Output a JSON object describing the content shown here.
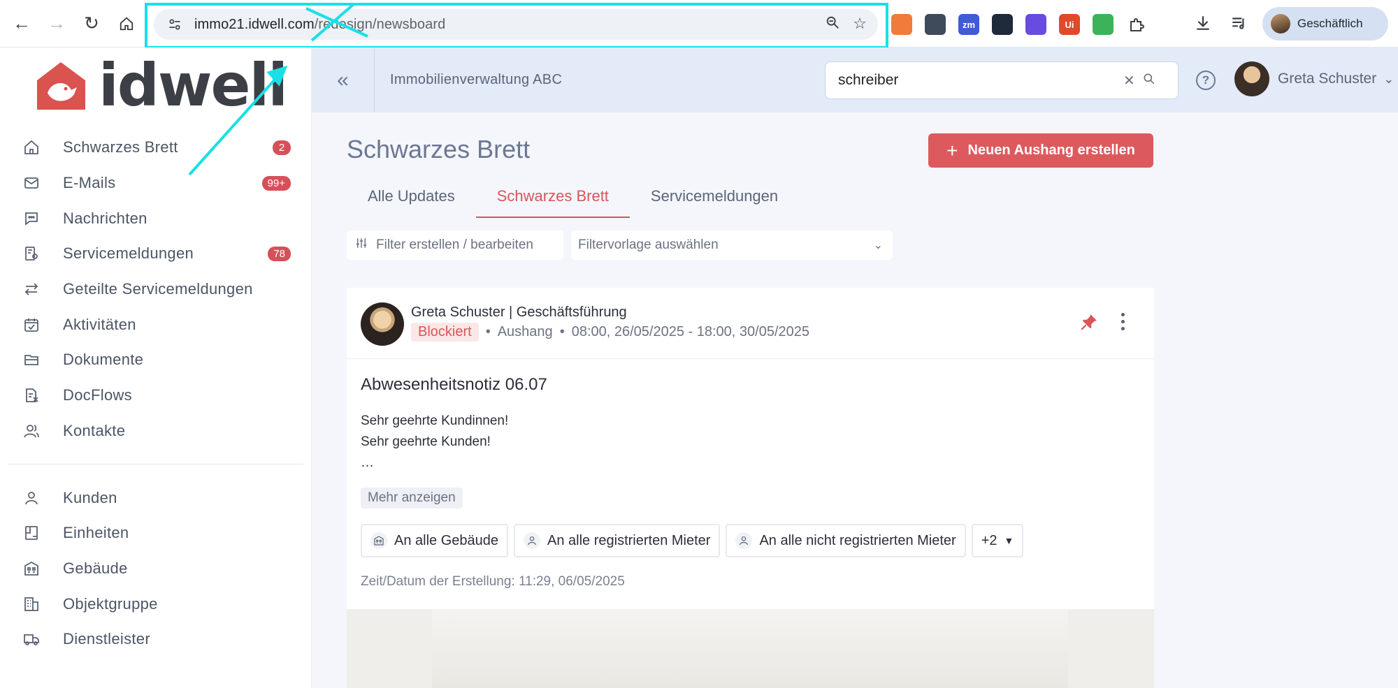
{
  "browser": {
    "url_host": "immo21.idwell.com",
    "url_path_struck": "/redesign",
    "url_path_rest": "/newsboard",
    "profile_label": "Geschäftlich",
    "extensions": [
      {
        "name": "layout-extension",
        "color": "#f07b3a",
        "text": ""
      },
      {
        "name": "puzzle-tool-extension",
        "color": "#3f4a5a",
        "text": ""
      },
      {
        "name": "zm-extension",
        "color": "#3f5bd6",
        "text": "zm"
      },
      {
        "name": "hex-extension",
        "color": "#1f2a3a",
        "text": ""
      },
      {
        "name": "star-extension",
        "color": "#6a4be0",
        "text": ""
      },
      {
        "name": "ui-extension",
        "color": "#e04a2a",
        "text": "Ui"
      },
      {
        "name": "code-extension",
        "color": "#3cb35a",
        "text": ""
      },
      {
        "name": "puzzle-extension",
        "color": "#ffffff",
        "text": ""
      }
    ]
  },
  "app": {
    "logo_text": "idwell",
    "org_name": "Immobilienverwaltung ABC",
    "search": {
      "value": "schreiber"
    },
    "user_name": "Greta Schuster"
  },
  "sidebar": {
    "primary": [
      {
        "id": "schwarzes-brett",
        "label": "Schwarzes Brett",
        "badge": "2",
        "icon": "home-icon"
      },
      {
        "id": "e-mails",
        "label": "E-Mails",
        "badge": "99+",
        "icon": "mail-icon"
      },
      {
        "id": "nachrichten",
        "label": "Nachrichten",
        "badge": "",
        "icon": "chat-icon"
      },
      {
        "id": "servicemeldungen",
        "label": "Servicemeldungen",
        "badge": "78",
        "icon": "service-icon"
      },
      {
        "id": "geteilte-servicemeldungen",
        "label": "Geteilte Servicemeldungen",
        "badge": "",
        "icon": "swap-icon"
      },
      {
        "id": "aktivitaeten",
        "label": "Aktivitäten",
        "badge": "",
        "icon": "calendar-check-icon"
      },
      {
        "id": "dokumente",
        "label": "Dokumente",
        "badge": "",
        "icon": "folder-icon"
      },
      {
        "id": "docflows",
        "label": "DocFlows",
        "badge": "",
        "icon": "docflow-icon"
      },
      {
        "id": "kontakte",
        "label": "Kontakte",
        "badge": "",
        "icon": "contacts-icon"
      }
    ],
    "secondary": [
      {
        "id": "kunden",
        "label": "Kunden",
        "icon": "user-icon"
      },
      {
        "id": "einheiten",
        "label": "Einheiten",
        "icon": "unit-icon"
      },
      {
        "id": "gebaeude",
        "label": "Gebäude",
        "icon": "building-icon"
      },
      {
        "id": "objektgruppe",
        "label": "Objektgruppe",
        "icon": "building-group-icon"
      },
      {
        "id": "dienstleister",
        "label": "Dienstleister",
        "icon": "truck-icon"
      }
    ]
  },
  "main": {
    "title": "Schwarzes Brett",
    "new_button": "Neuen Aushang erstellen",
    "tabs": [
      {
        "label": "Alle Updates",
        "active": false
      },
      {
        "label": "Schwarzes Brett",
        "active": true
      },
      {
        "label": "Servicemeldungen",
        "active": false
      }
    ],
    "filter_button": "Filter erstellen / bearbeiten",
    "filter_select": "Filtervorlage auswählen"
  },
  "post": {
    "author": "Greta Schuster | Geschäftsführung",
    "status": "Blockiert",
    "type": "Aushang",
    "period": "08:00, 26/05/2025 - 18:00, 30/05/2025",
    "title": "Abwesenheitsnotiz 06.07",
    "body_lines": [
      "Sehr geehrte Kundinnen!",
      "Sehr geehrte Kunden!",
      " …"
    ],
    "more_label": "Mehr anzeigen",
    "audiences": [
      {
        "label": "An alle Gebäude",
        "icon": "building-icon"
      },
      {
        "label": "An alle registrierten Mieter",
        "icon": "user-icon"
      },
      {
        "label": "An alle nicht registrierten Mieter",
        "icon": "user-icon"
      }
    ],
    "audience_more": "+2",
    "created": "Zeit/Datum der Erstellung: 11:29, 06/05/2025"
  },
  "colors": {
    "accent": "#dc5a5d",
    "annotation": "#19e0e6",
    "topbar": "#e3ebf9"
  }
}
